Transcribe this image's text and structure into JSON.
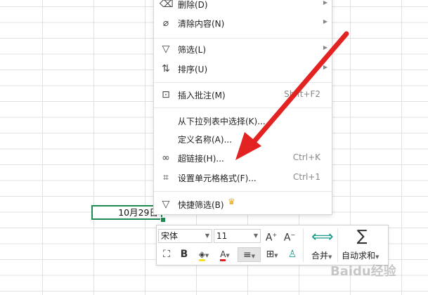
{
  "cell": {
    "value": "10月29日"
  },
  "menu": {
    "items": [
      {
        "icon": "delete-icon",
        "label": "删除(D)",
        "shortcut": "",
        "submenu": true
      },
      {
        "icon": "clear-content-icon",
        "label": "清除内容(N)",
        "shortcut": "",
        "submenu": true
      },
      {
        "icon": "filter-icon",
        "label": "筛选(L)",
        "shortcut": "",
        "submenu": true
      },
      {
        "icon": "sort-icon",
        "label": "排序(U)",
        "shortcut": "",
        "submenu": true
      },
      {
        "icon": "comment-icon",
        "label": "插入批注(M)",
        "shortcut": "Shift+F2",
        "submenu": false
      },
      {
        "icon": "",
        "label": "从下拉列表中选择(K)...",
        "shortcut": "",
        "submenu": false
      },
      {
        "icon": "",
        "label": "定义名称(A)...",
        "shortcut": "",
        "submenu": false
      },
      {
        "icon": "link-icon",
        "label": "超链接(H)...",
        "shortcut": "Ctrl+K",
        "submenu": false
      },
      {
        "icon": "format-cells-icon",
        "label": "设置单元格格式(F)...",
        "shortcut": "Ctrl+1",
        "submenu": false
      },
      {
        "icon": "quick-filter-icon",
        "label": "快捷筛选(B)",
        "shortcut": "",
        "submenu": false
      }
    ]
  },
  "toolbar": {
    "font_name": "宋体",
    "font_size": "11",
    "merge_label": "合并",
    "autosum_label": "自动求和"
  },
  "watermark": "Baidu经验",
  "colors": {
    "accent": "#1e8a4f",
    "arrow": "#e32222",
    "font_color": "#e02020",
    "highlight": "#f5e21a"
  }
}
